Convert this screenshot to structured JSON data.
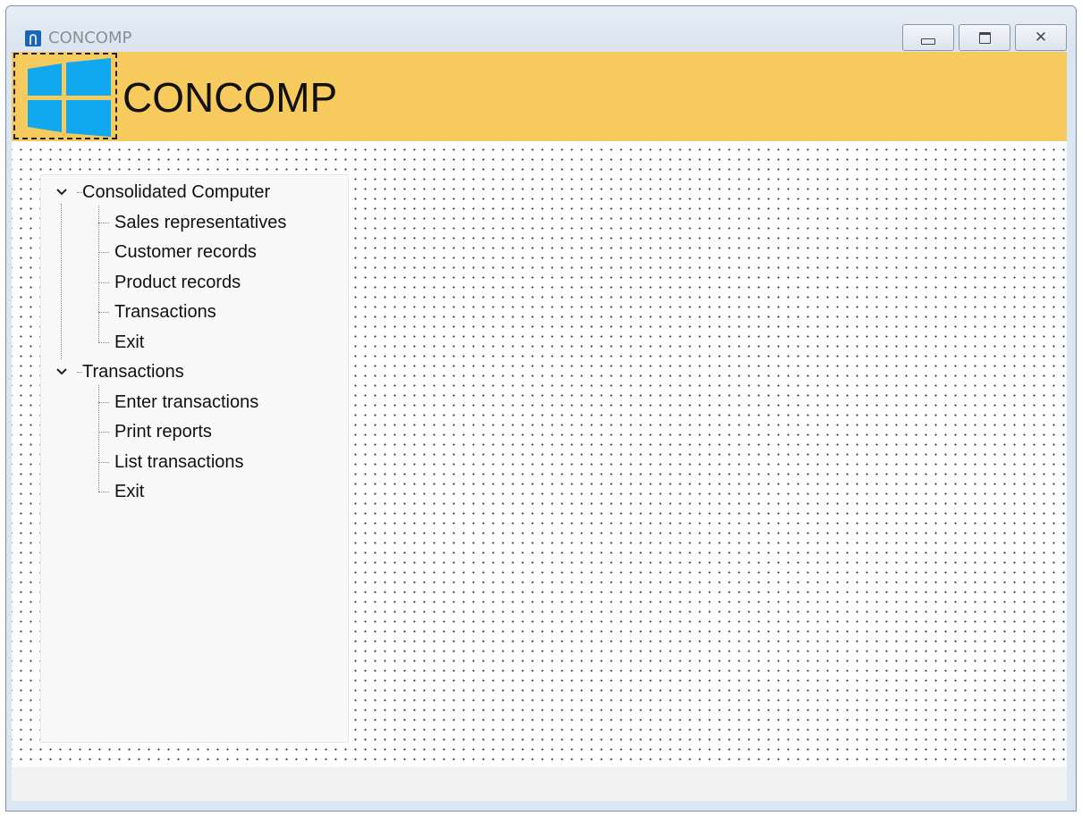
{
  "window": {
    "title": "CONCOMP",
    "controls": {
      "minimize": "minimize",
      "maximize": "maximize",
      "close": "close"
    }
  },
  "banner": {
    "title": "CONCOMP",
    "logo_icon": "windows-logo-icon",
    "color": "#f7ca5d",
    "logo_color": "#10a8f0"
  },
  "tree": {
    "groups": [
      {
        "label": "Consolidated Computer",
        "expanded": true,
        "items": [
          {
            "label": "Sales representatives"
          },
          {
            "label": "Customer records"
          },
          {
            "label": "Product records"
          },
          {
            "label": "Transactions"
          },
          {
            "label": "Exit"
          }
        ]
      },
      {
        "label": "Transactions",
        "expanded": true,
        "items": [
          {
            "label": "Enter transactions"
          },
          {
            "label": "Print reports"
          },
          {
            "label": "List transactions"
          },
          {
            "label": "Exit"
          }
        ]
      }
    ]
  }
}
